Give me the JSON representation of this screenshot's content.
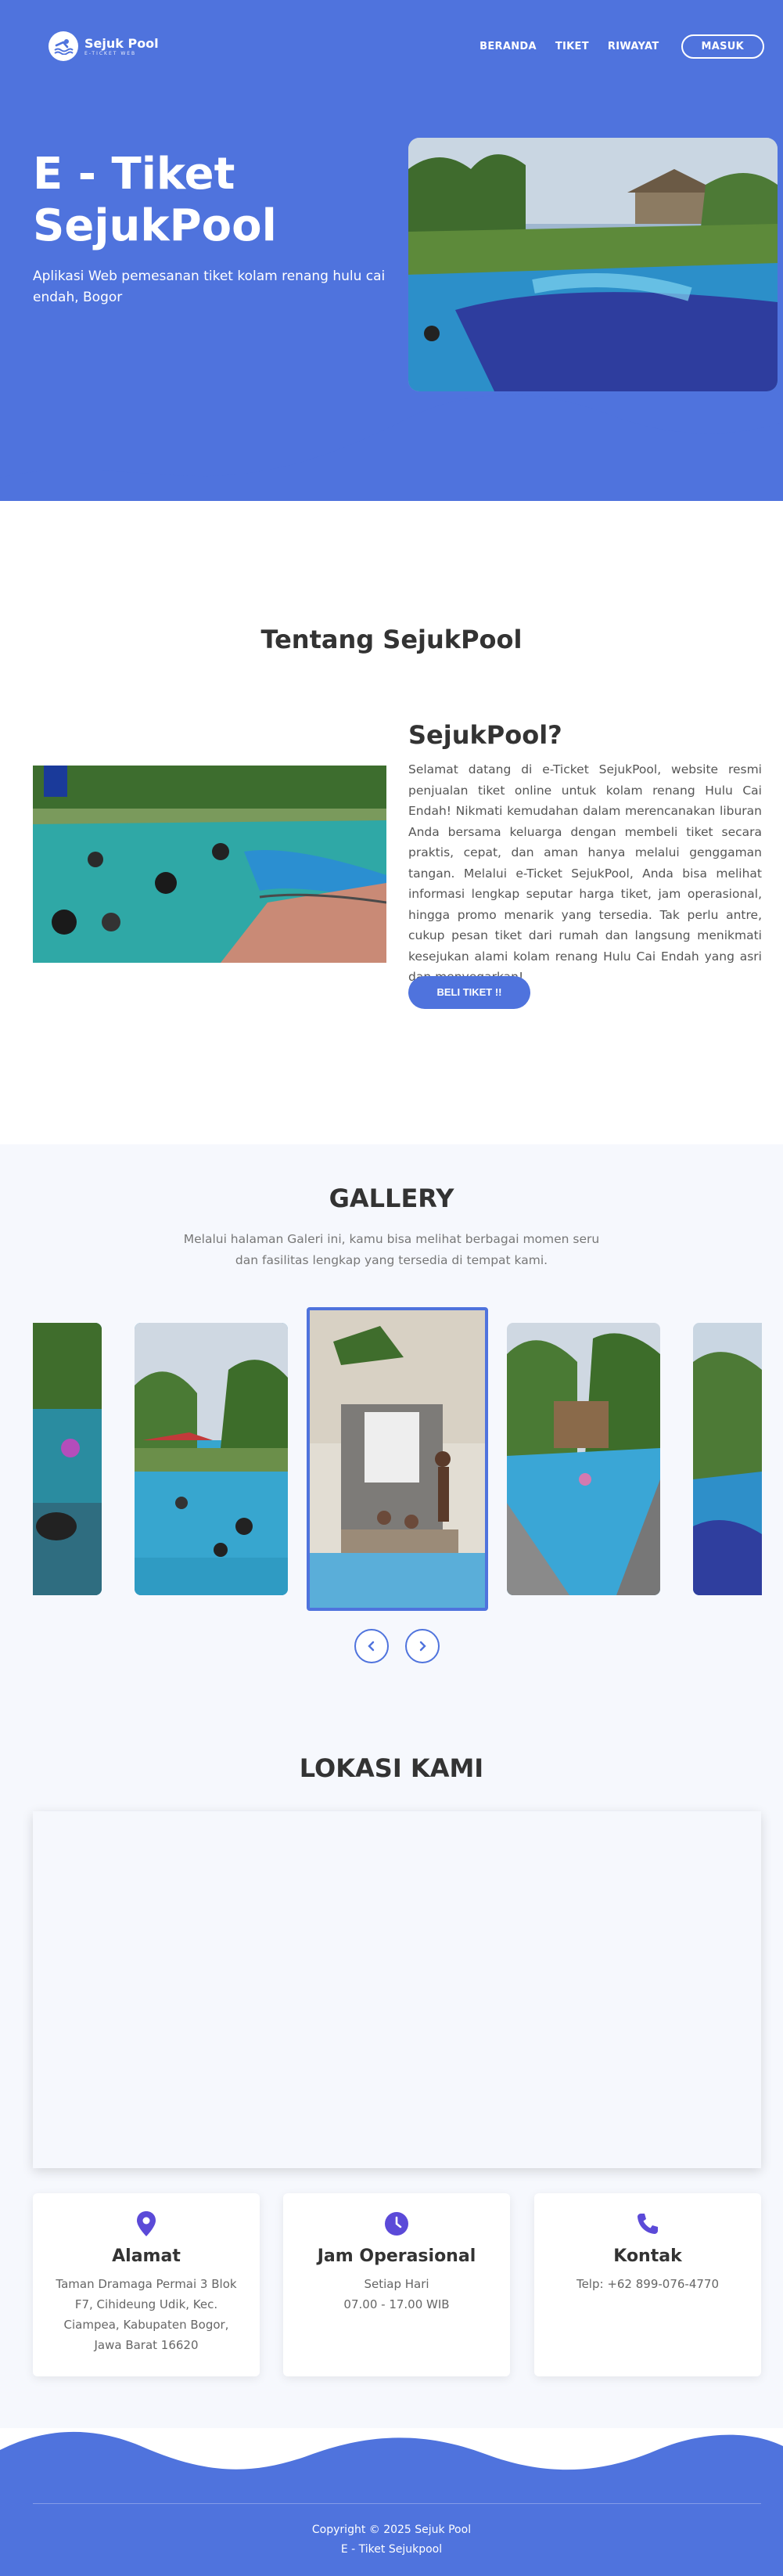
{
  "brand": {
    "name": "Sejuk Pool",
    "tagline": "E-TICKET WEB"
  },
  "nav": {
    "items": [
      "BERANDA",
      "TIKET",
      "RIWAYAT"
    ],
    "login_label": "MASUK"
  },
  "hero": {
    "title": "E - Tiket SejukPool",
    "description": "Aplikasi Web pemesanan tiket kolam renang hulu cai endah, Bogor"
  },
  "about": {
    "section_title": "Tentang SejukPool",
    "heading": "SejukPool?",
    "paragraph": "Selamat datang di e-Ticket SejukPool, website resmi penjualan tiket online untuk kolam renang Hulu Cai Endah! Nikmati kemudahan dalam merencanakan liburan Anda bersama keluarga dengan membeli tiket secara praktis, cepat, dan aman hanya melalui genggaman tangan. Melalui e-Ticket SejukPool, Anda bisa melihat informasi lengkap seputar harga tiket, jam operasional, hingga promo menarik yang tersedia. Tak perlu antre, cukup pesan tiket dari rumah dan langsung menikmati kesejukan alami kolam renang Hulu Cai Endah yang asri dan menyegarkan!",
    "buy_button": "BELI TIKET !!"
  },
  "gallery": {
    "title": "GALLERY",
    "description": "Melalui halaman Galeri ini, kamu bisa melihat berbagai momen seru dan fasilitas lengkap yang tersedia di tempat kami."
  },
  "location": {
    "title": "LOKASI KAMI",
    "cards": [
      {
        "icon": "map-pin-icon",
        "title": "Alamat",
        "text": "Taman Dramaga Permai 3 Blok F7, Cihideung Udik, Kec. Ciampea, Kabupaten Bogor, Jawa Barat 16620"
      },
      {
        "icon": "clock-icon",
        "title": "Jam Operasional",
        "text": "Setiap Hari\n07.00 - 17.00 WIB"
      },
      {
        "icon": "phone-icon",
        "title": "Kontak",
        "text": "Telp: +62 899-076-4770"
      }
    ]
  },
  "footer": {
    "copyright": "Copyright © 2025 Sejuk Pool",
    "subtitle": "E - Tiket Sejukpool"
  },
  "colors": {
    "primary": "#4f73dd",
    "accent": "#5b4ad8",
    "background_alt": "#f6f8fd"
  }
}
